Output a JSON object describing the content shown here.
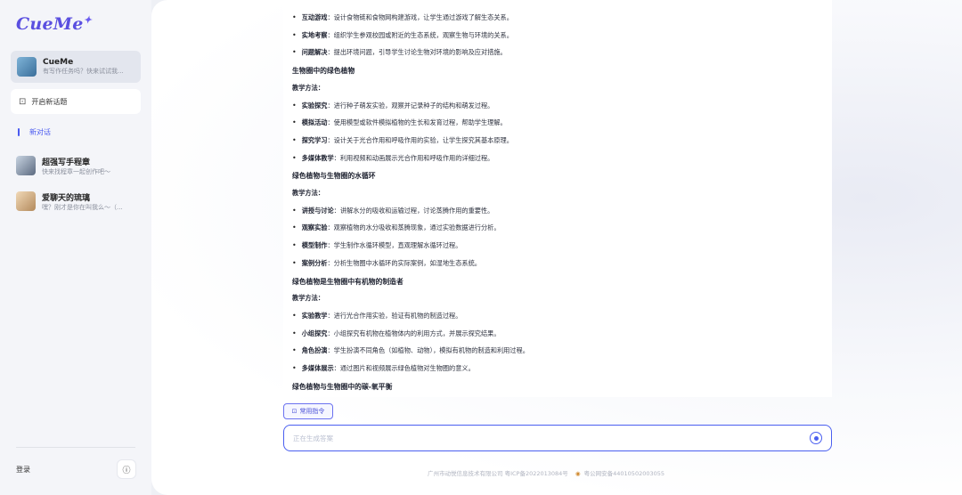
{
  "app": {
    "logo": "CueMe",
    "logo_star": "✦"
  },
  "sidebar": {
    "bot_card": {
      "title": "CueMe",
      "subtitle": "有写作任务吗？快来试试我..."
    },
    "new_topic_label": "开启新话题",
    "new_chat_label": "新对话",
    "chats": [
      {
        "title": "超强写手程章",
        "subtitle": "快来找程章一起创作吧～"
      },
      {
        "title": "爱聊天的琉璃",
        "subtitle": "嘿？刚才是你在叫我么～（..."
      }
    ],
    "login_label": "登录",
    "info_icon": "ⓘ"
  },
  "content": {
    "lines": [
      {
        "type": "bullet",
        "label": "互动游戏",
        "text": "：设计食物链和食物网构建游戏，让学生通过游戏了解生态关系。"
      },
      {
        "type": "bullet",
        "label": "实地考察",
        "text": "：组织学生参观校园或附近的生态系统，观察生物与环境的关系。"
      },
      {
        "type": "bullet",
        "label": "问题解决",
        "text": "：提出环境问题，引导学生讨论生物对环境的影响及应对措施。"
      },
      {
        "type": "heading",
        "text": "生物圈中的绿色植物"
      },
      {
        "type": "sub",
        "text": "教学方法："
      },
      {
        "type": "bullet",
        "label": "实验探究",
        "text": "：进行种子萌发实验，观察并记录种子的结构和萌发过程。"
      },
      {
        "type": "bullet",
        "label": "模拟活动",
        "text": "：使用模型或软件模拟植物的生长和发育过程，帮助学生理解。"
      },
      {
        "type": "bullet",
        "label": "探究学习",
        "text": "：设计关于光合作用和呼吸作用的实验，让学生探究其基本原理。"
      },
      {
        "type": "bullet",
        "label": "多媒体教学",
        "text": "：利用视频和动画展示光合作用和呼吸作用的详细过程。"
      },
      {
        "type": "heading",
        "text": "绿色植物与生物圈的水循环"
      },
      {
        "type": "sub",
        "text": "教学方法："
      },
      {
        "type": "bullet",
        "label": "讲授与讨论",
        "text": "：讲解水分的吸收和运输过程，讨论蒸腾作用的重要性。"
      },
      {
        "type": "bullet",
        "label": "观察实验",
        "text": "：观察植物的水分吸收和蒸腾现象，通过实验数据进行分析。"
      },
      {
        "type": "bullet",
        "label": "模型制作",
        "text": "：学生制作水循环模型，直观理解水循环过程。"
      },
      {
        "type": "bullet",
        "label": "案例分析",
        "text": "：分析生物圈中水循环的实际案例，如湿地生态系统。"
      },
      {
        "type": "heading",
        "text": "绿色植物是生物圈中有机物的制造者"
      },
      {
        "type": "sub",
        "text": "教学方法："
      },
      {
        "type": "bullet",
        "label": "实验教学",
        "text": "：进行光合作用实验，验证有机物的制造过程。"
      },
      {
        "type": "bullet",
        "label": "小组探究",
        "text": "：小组探究有机物在植物体内的利用方式，并展示探究结果。"
      },
      {
        "type": "bullet",
        "label": "角色扮演",
        "text": "：学生扮演不同角色（如植物、动物），模拟有机物的制造和利用过程。"
      },
      {
        "type": "bullet",
        "label": "多媒体展示",
        "text": "：通过图片和视频展示绿色植物对生物圈的意义。"
      },
      {
        "type": "heading",
        "text": "绿色植物与生物圈中的碳-氧平衡"
      }
    ]
  },
  "composer": {
    "common_commands_label": "常用指令",
    "placeholder": "正在生成答案"
  },
  "footer": {
    "company": "广州市动悦信息技术有限公司 粤ICP备2022013084号",
    "police": "粤公网安备44010502003055"
  }
}
